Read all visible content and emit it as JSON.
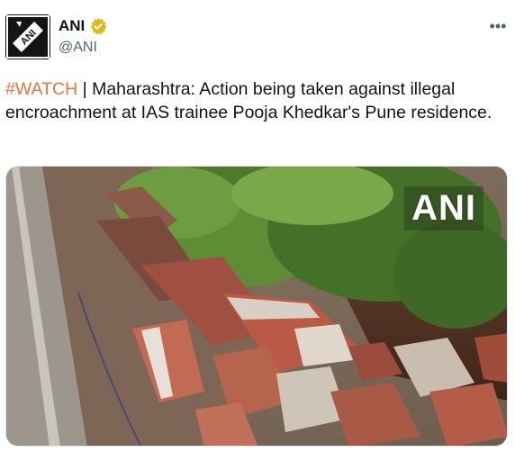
{
  "author": {
    "name": "ANI",
    "handle": "@ANI",
    "avatar_text": "ANI",
    "verified_icon": "gold-verified-badge"
  },
  "more_icon": "more-dots-icon",
  "more_label": "•••",
  "tweet": {
    "hashtag": "#WATCH",
    "separator": " | ",
    "body": "Maharashtra: Action being taken against illegal encroachment at IAS trainee Pooja Khedkar's Pune residence."
  },
  "media": {
    "watermark": "ANI",
    "description_icon": "demolished-wall-photo"
  },
  "colors": {
    "hashtag": "#f2713a",
    "handle": "#536471",
    "verified_gold": "#e2b719"
  }
}
